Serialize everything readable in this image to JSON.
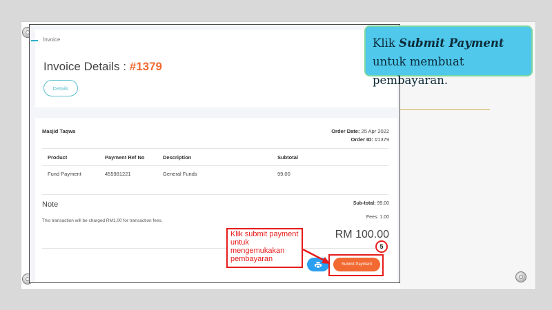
{
  "breadcrumb": "Invoice",
  "invoice": {
    "title_prefix": "Invoice Details : ",
    "number": "#1379",
    "details_button": "Details"
  },
  "order": {
    "organization": "Masjid Taqwa",
    "date_label": "Order Date:",
    "date_value": "25 Apr 2022",
    "id_label": "Order ID:",
    "id_value": "#1379"
  },
  "table": {
    "headers": [
      "Product",
      "Payment Ref No",
      "Description",
      "Subtotal"
    ],
    "rows": [
      [
        "Fund Payment",
        "455981221",
        "General Funds",
        "99.00"
      ]
    ]
  },
  "note": {
    "title": "Note",
    "text": "This transaction will be charged RM1.00 for transaction fees."
  },
  "totals": {
    "subtotal_label": "Sub-total:",
    "subtotal_value": "99.00",
    "fees_label": "Fees:",
    "fees_value": "1.00",
    "grand_total": "RM 100.00"
  },
  "buttons": {
    "submit": "Submit Payment"
  },
  "annotation": {
    "callout": "Klik submit payment untuk mengemukakan pembayaran",
    "step": "5"
  },
  "tip": {
    "prefix": "Klik ",
    "emphasis": "Submit Payment",
    "suffix": "untuk membuat pembayaran."
  },
  "colors": {
    "accent_orange": "#f26a32",
    "print_blue": "#2b9ff0",
    "teal": "#58bfcc",
    "annotation_red": "#e81b1b",
    "tip_blue": "#4fc8ec"
  },
  "icons": [
    "print-icon",
    "pin-icon"
  ]
}
